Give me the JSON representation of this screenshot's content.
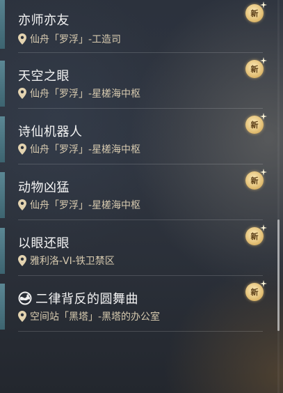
{
  "badge_label": "新",
  "quests": [
    {
      "title": "亦师亦友",
      "location": "仙舟「罗浮」-工造司",
      "new": true,
      "type_icon": null
    },
    {
      "title": "天空之眼",
      "location": "仙舟「罗浮」-星槎海中枢",
      "new": true,
      "type_icon": null
    },
    {
      "title": "诗仙机器人",
      "location": "仙舟「罗浮」-星槎海中枢",
      "new": true,
      "type_icon": null
    },
    {
      "title": "动物凶猛",
      "location": "仙舟「罗浮」-星槎海中枢",
      "new": true,
      "type_icon": null
    },
    {
      "title": "以眼还眼",
      "location": "雅利洛-VI-铁卫禁区",
      "new": true,
      "type_icon": null
    },
    {
      "title": "二律背反的圆舞曲",
      "location": "空间站「黑塔」-黑塔的办公室",
      "new": true,
      "type_icon": "mission-type-icon"
    }
  ],
  "icons": {
    "location": "location-pin-icon",
    "new": "new-badge-icon"
  },
  "colors": {
    "accent_bar": "#4f7987",
    "title_text": "#f4f4f4",
    "location_text": "#d8cbb0",
    "badge_gold": "#e6c47c"
  }
}
